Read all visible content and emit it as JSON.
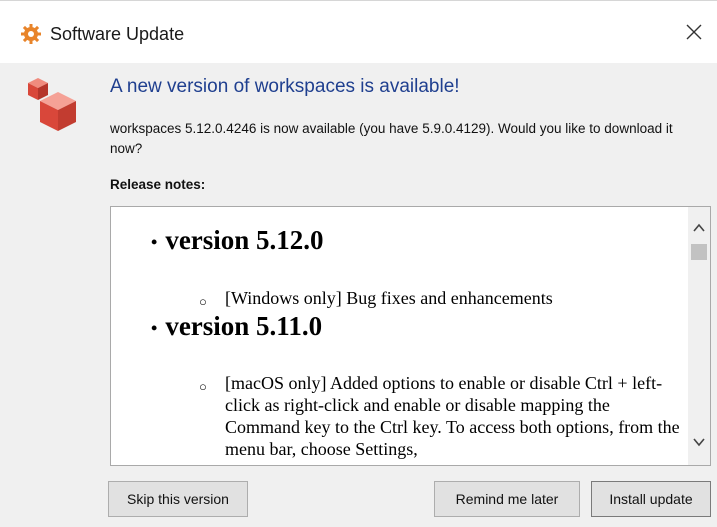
{
  "window": {
    "title": "Software Update",
    "icon": "gear-icon"
  },
  "header": {
    "headline": "A new version of workspaces is available!",
    "description": "workspaces 5.12.0.4246 is now available (you have 5.9.0.4129). Would you like to download it now?"
  },
  "release_notes": {
    "label": "Release notes:",
    "items": [
      {
        "version": "version 5.12.0",
        "notes": [
          "[Windows only] Bug fixes and enhancements"
        ]
      },
      {
        "version": "version 5.11.0",
        "notes": [
          "[macOS only] Added options to enable or disable Ctrl + left-click as right-click and enable or disable mapping the Command key to the Ctrl key. To access both options, from the menu bar, choose Settings,"
        ]
      }
    ]
  },
  "buttons": {
    "skip": "Skip this version",
    "remind": "Remind me later",
    "install": "Install update"
  },
  "colors": {
    "headline": "#1f3f8f",
    "logo_red": "#d9473a",
    "gear_orange": "#e8842a"
  }
}
